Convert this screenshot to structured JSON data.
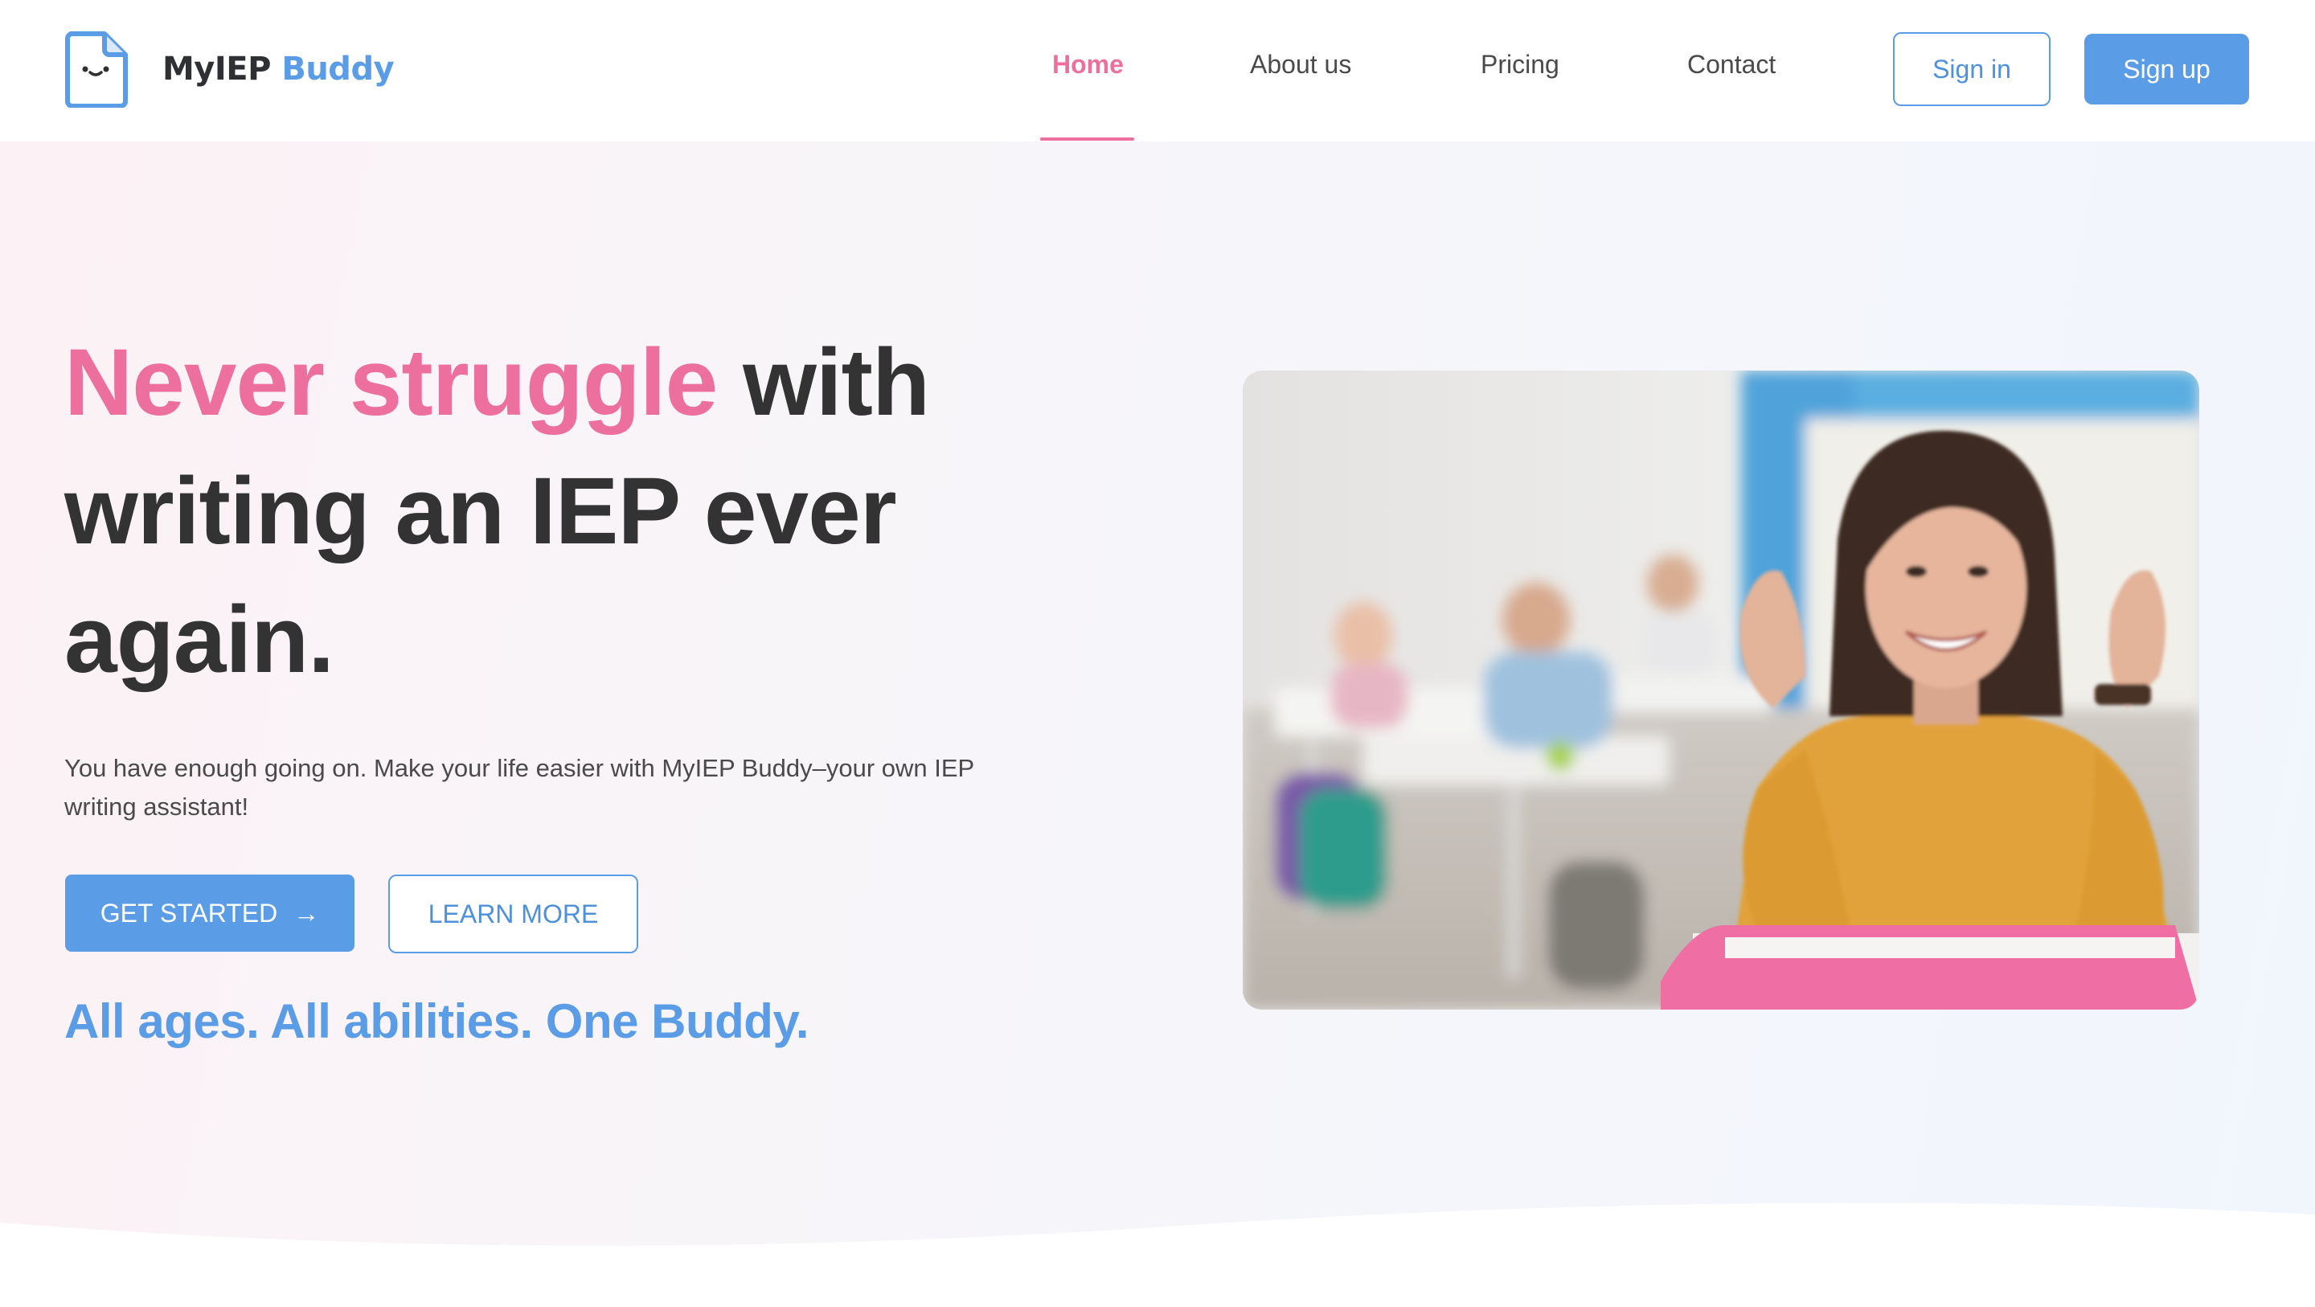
{
  "brand": {
    "name_part1": "MyIEP",
    "name_part2": "Buddy",
    "icon": "smiling-document-icon"
  },
  "nav": {
    "items": [
      {
        "label": "Home",
        "active": true
      },
      {
        "label": "About us",
        "active": false
      },
      {
        "label": "Pricing",
        "active": false
      },
      {
        "label": "Contact",
        "active": false
      }
    ],
    "sign_in": "Sign in",
    "sign_up": "Sign up"
  },
  "hero": {
    "headline_highlight": "Never struggle",
    "headline_rest": " with writing an IEP ever again.",
    "subtext": "You have enough going on. Make your life easier with MyIEP Buddy–your own IEP writing assistant!",
    "cta_primary": "GET STARTED",
    "cta_primary_icon": "arrow-right-icon",
    "cta_secondary": "LEARN MORE",
    "tagline": "All ages. All abilities. One Buddy."
  },
  "colors": {
    "pink_accent": "#ec6f9e",
    "blue_accent": "#5a9de6",
    "text_dark": "#333333"
  }
}
